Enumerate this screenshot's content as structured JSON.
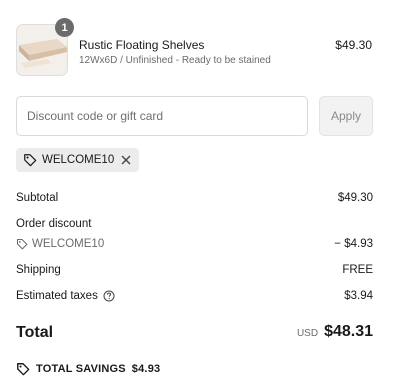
{
  "cart_item": {
    "quantity": "1",
    "name": "Rustic Floating Shelves",
    "variant": "12Wx6D / Unfinished - Ready to be stained",
    "price": "$49.30",
    "image_icon": "wood-shelf-image"
  },
  "discount": {
    "placeholder": "Discount code or gift card",
    "value": "",
    "apply_label": "Apply",
    "applied_code": "WELCOME10"
  },
  "summary": {
    "subtotal_label": "Subtotal",
    "subtotal_value": "$49.30",
    "order_discount_label": "Order discount",
    "discount_code": "WELCOME10",
    "discount_value": "− $4.93",
    "shipping_label": "Shipping",
    "shipping_value": "FREE",
    "taxes_label": "Estimated taxes",
    "taxes_value": "$3.94",
    "total_label": "Total",
    "currency": "USD",
    "total_value": "$48.31",
    "savings_label": "TOTAL SAVINGS",
    "savings_value": "$4.93"
  },
  "colors": {
    "text": "#1a1a1a",
    "muted": "#6b6b6b",
    "chip_bg": "#ececec",
    "badge_bg": "#6b6b6b",
    "button_bg": "#f2f2f2"
  }
}
